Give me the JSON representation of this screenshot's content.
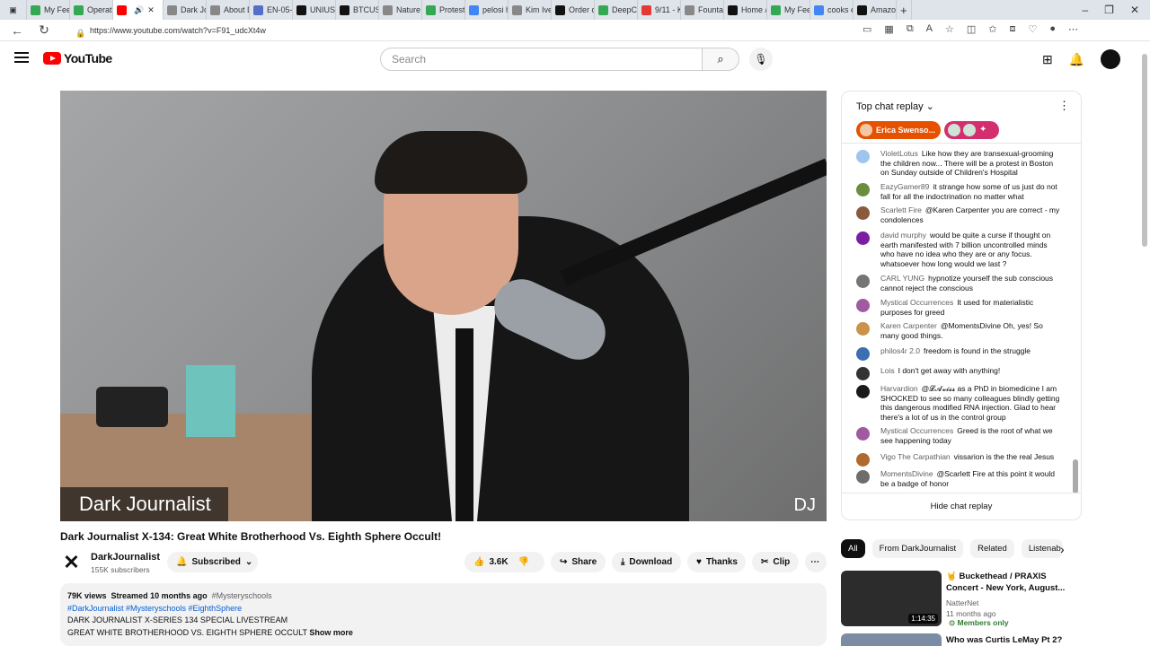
{
  "tabs": [
    {
      "label": "My Feed",
      "color": "#34a853"
    },
    {
      "label": "Operati",
      "color": "#34a853"
    },
    {
      "label": "",
      "color": "#ff0000",
      "active": true
    },
    {
      "label": "Dark Jo",
      "color": "#888888"
    },
    {
      "label": "About D",
      "color": "#888888"
    },
    {
      "label": "EN-05-",
      "color": "#5470c6"
    },
    {
      "label": "UNIUSD",
      "color": "#111111"
    },
    {
      "label": "BTCUSD",
      "color": "#111111"
    },
    {
      "label": "Nature",
      "color": "#888888"
    },
    {
      "label": "Proteste",
      "color": "#34a853"
    },
    {
      "label": "pelosi h",
      "color": "#4285f4"
    },
    {
      "label": "Kim Iver",
      "color": "#888888"
    },
    {
      "label": "Order d",
      "color": "#111111"
    },
    {
      "label": "DeepCo",
      "color": "#34a853"
    },
    {
      "label": "9/11 - K",
      "color": "#e53935"
    },
    {
      "label": "Fountai",
      "color": "#888888"
    },
    {
      "label": "Home /",
      "color": "#111111"
    },
    {
      "label": "My Feed",
      "color": "#34a853"
    },
    {
      "label": "cooks e",
      "color": "#4285f4"
    },
    {
      "label": "Amazon",
      "color": "#111111"
    }
  ],
  "window_controls": {
    "minimize": "–",
    "restore": "❐",
    "close": "✕"
  },
  "address": {
    "url": "https://www.youtube.com/watch?v=F91_udcXt4w"
  },
  "youtube": {
    "logo_text": "YouTube",
    "search_placeholder": "Search"
  },
  "video": {
    "overlay_label": "Dark Journalist",
    "watermark": "DJ",
    "title": "Dark Journalist X-134: Great White Brotherhood Vs. Eighth Sphere Occult!",
    "channel": "DarkJournalist",
    "subscribers": "155K subscribers",
    "subscribe_label": "Subscribed",
    "likes": "3.6K",
    "share": "Share",
    "download": "Download",
    "thanks": "Thanks",
    "clip": "Clip"
  },
  "description": {
    "views": "79K views",
    "streamed": "Streamed 10 months ago",
    "tag1": "#Mysteryschools",
    "tags_line": "#DarkJournalist #Mysteryschools #EighthSphere",
    "line1": "DARK JOURNALIST X-SERIES 134 SPECIAL LIVESTREAM",
    "line2": "GREAT WHITE BROTHERHOOD VS. EIGHTH SPHERE OCCULT",
    "show_more": "Show more"
  },
  "chat": {
    "title": "Top chat replay",
    "chip_name": "Erica Swenso...",
    "hide_label": "Hide chat replay",
    "messages": [
      {
        "author": "VioletLotus",
        "text": "Like how they are transexual-grooming the children now... There will be a protest in Boston on Sunday outside of Children's Hospital",
        "color": "#9ec5ef"
      },
      {
        "author": "EazyGamer89",
        "text": "it strange how some of us just do not fall for all the indoctrination no matter what",
        "color": "#6b8e3e"
      },
      {
        "author": "Scarlett Fire",
        "text": "@Karen Carpenter you are correct - my condolences",
        "color": "#8a5a3c"
      },
      {
        "author": "david murphy",
        "text": "would be quite a curse if thought on earth manifested with 7 billion uncontrolled minds who have no idea who they are or any focus. whatsoever how long would we last ?",
        "color": "#7b1fa2"
      },
      {
        "author": "CARL YUNG",
        "text": "hypnotize yourself the sub conscious cannot reject the conscious",
        "color": "#757575"
      },
      {
        "author": "Mystical Occurrences",
        "text": "It used for materialistic purposes for greed",
        "color": "#a05ba0"
      },
      {
        "author": "Karen Carpenter",
        "text": "@MomentsDivine Oh, yes! So many good things.",
        "color": "#c9934a"
      },
      {
        "author": "philos4r 2.0",
        "text": "freedom is found in the struggle",
        "color": "#3a6fb0"
      },
      {
        "author": "Lois",
        "text": "I don't get away with anything!",
        "color": "#333333"
      },
      {
        "author": "Harvardion",
        "text": "@𝓛𝓐𝓿𝓲𝓼𝓼 as a PhD in biomedicine I am SHOCKED to see so many colleagues blindly getting this dangerous modified RNA injection. Glad to hear there's a lot of us in the control group",
        "color": "#1a1a1a"
      },
      {
        "author": "Mystical Occurrences",
        "text": "Greed is the root of what we see happening today",
        "color": "#a05ba0"
      },
      {
        "author": "Vigo The Carpathian",
        "text": "vissarion is the the real Jesus",
        "color": "#b06a30"
      },
      {
        "author": "MomentsDivine",
        "text": "@Scarlett Fire at this point it would be a badge of honor",
        "color": "#6d6d6d"
      }
    ]
  },
  "filters": [
    "All",
    "From DarkJournalist",
    "Related",
    "Listenab"
  ],
  "recommended": [
    {
      "title": "🤘 Buckethead / PRAXIS Concert - New York, August...",
      "channel": "NatterNet",
      "age": "11 months ago",
      "duration": "1:14:35",
      "badge": "Members only"
    },
    {
      "title": "Who was Curtis LeMay Pt 2?"
    }
  ]
}
